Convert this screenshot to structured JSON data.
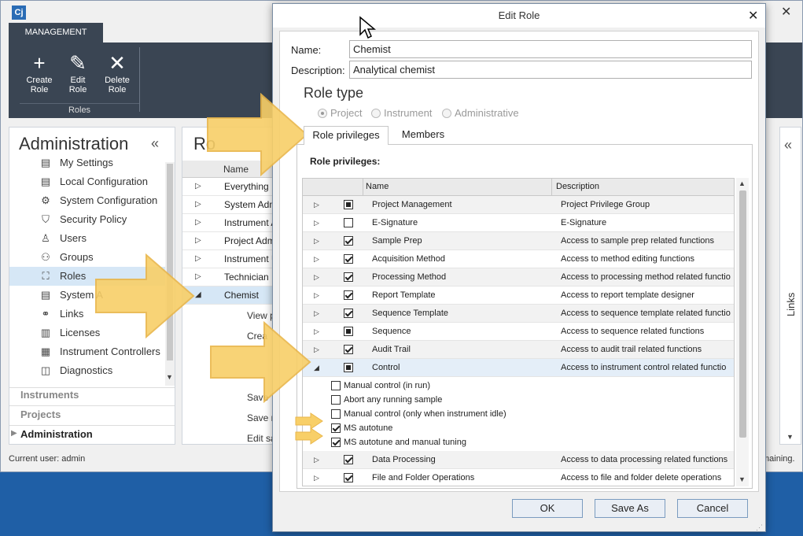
{
  "app": {
    "logo": "Cj"
  },
  "ribbon": {
    "tab": "MANAGEMENT",
    "buttons": [
      {
        "label": "Create\nRole",
        "icon": "plus-icon"
      },
      {
        "label": "Edit\nRole",
        "icon": "pencil-icon"
      },
      {
        "label": "Delete\nRole",
        "icon": "x-icon"
      }
    ],
    "group": "Roles"
  },
  "nav": {
    "title": "Administration",
    "items": [
      {
        "label": "My Settings",
        "icon": "settings-doc-icon"
      },
      {
        "label": "Local Configuration",
        "icon": "doc-icon"
      },
      {
        "label": "System Configuration",
        "icon": "gear-icon"
      },
      {
        "label": "Security Policy",
        "icon": "shield-icon"
      },
      {
        "label": "Users",
        "icon": "user-icon"
      },
      {
        "label": "Groups",
        "icon": "group-icon"
      },
      {
        "label": "Roles",
        "icon": "role-icon"
      },
      {
        "label": "System A",
        "icon": "doc-icon"
      },
      {
        "label": "Links",
        "icon": "link-icon"
      },
      {
        "label": "Licenses",
        "icon": "license-icon"
      },
      {
        "label": "Instrument Controllers",
        "icon": "controller-icon"
      },
      {
        "label": "Diagnostics",
        "icon": "chart-icon"
      }
    ],
    "sections": [
      "Instruments",
      "Projects",
      "Administration"
    ]
  },
  "roles": {
    "title": "Ro",
    "column": "Name",
    "rows": [
      "Everything",
      "System Adm",
      "Instrument A",
      "Project Adm",
      "Instrument U",
      "Technician",
      "Chemist"
    ],
    "subitems": [
      "View p",
      "Crea",
      "Save",
      "Save re",
      "Edit sa"
    ]
  },
  "links": {
    "label": "Links"
  },
  "status": {
    "user": "Current user: admin",
    "right": "maining."
  },
  "dialog": {
    "title": "Edit Role",
    "name_label": "Name:",
    "name_value": "Chemist",
    "desc_label": "Description:",
    "desc_value": "Analytical chemist",
    "role_type": "Role type",
    "radios": [
      "Project",
      "Instrument",
      "Administrative"
    ],
    "tabs": [
      "Role privileges",
      "Members"
    ],
    "privileges_title": "Role privileges:",
    "columns": [
      "Name",
      "Description"
    ],
    "rows": [
      {
        "name": "Project Management",
        "desc": "Project Privilege Group",
        "state": "partial"
      },
      {
        "name": "E-Signature",
        "desc": "E-Signature",
        "state": "off"
      },
      {
        "name": "Sample Prep",
        "desc": "Access to sample prep related functions",
        "state": "on"
      },
      {
        "name": "Acquisition Method",
        "desc": "Access to method editing functions",
        "state": "on"
      },
      {
        "name": "Processing Method",
        "desc": "Access to processing method related functio",
        "state": "on"
      },
      {
        "name": "Report Template",
        "desc": "Access to report template designer",
        "state": "on"
      },
      {
        "name": "Sequence Template",
        "desc": "Access to sequence template related functio",
        "state": "on"
      },
      {
        "name": "Sequence",
        "desc": "Access to sequence related functions",
        "state": "partial"
      },
      {
        "name": "Audit Trail",
        "desc": "Access to audit trail related functions",
        "state": "on"
      },
      {
        "name": "Control",
        "desc": "Access to instrument control related functio",
        "state": "partial"
      }
    ],
    "subrows": [
      {
        "name": "Manual control (in run)",
        "state": "off"
      },
      {
        "name": "Abort any running sample",
        "state": "off"
      },
      {
        "name": "Manual control (only when instrument idle)",
        "state": "off"
      },
      {
        "name": "MS autotune",
        "state": "on"
      },
      {
        "name": "MS autotune and manual tuning",
        "state": "on"
      }
    ],
    "rows_after": [
      {
        "name": "Data Processing",
        "desc": "Access to data processing related functions",
        "state": "on"
      },
      {
        "name": "File and Folder Operations",
        "desc": "Access to file and folder delete operations",
        "state": "on"
      }
    ],
    "buttons": {
      "ok": "OK",
      "save_as": "Save As",
      "cancel": "Cancel"
    }
  },
  "colors": {
    "ribbon": "#3a4553",
    "selection": "#d6e7f6",
    "arrow": "#f5c542",
    "desktop": "#1f5fa6"
  }
}
